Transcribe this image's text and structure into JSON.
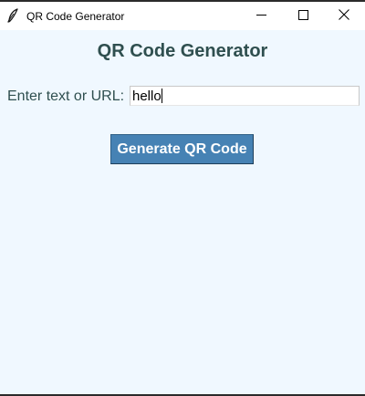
{
  "window": {
    "title": "QR Code Generator",
    "icon": "feather-icon",
    "controls": {
      "minimize_icon": "minimize-icon",
      "maximize_icon": "maximize-icon",
      "close_icon": "close-icon"
    }
  },
  "main": {
    "heading": "QR Code Generator",
    "input_label": "Enter text or URL:",
    "input_value": "hello",
    "generate_button_label": "Generate QR Code"
  },
  "colors": {
    "background": "#f0f8ff",
    "heading_text": "#2f4f4f",
    "button_bg": "#4682b4",
    "button_text": "#ffffff"
  }
}
